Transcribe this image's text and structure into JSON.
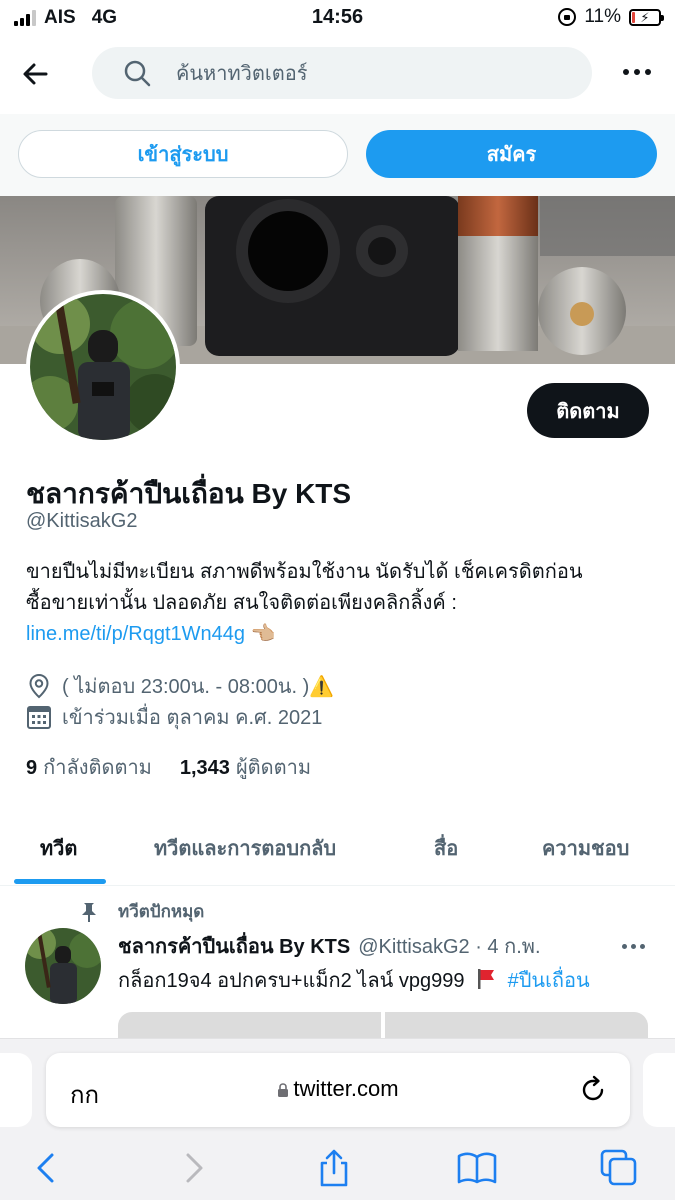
{
  "status_bar": {
    "carrier": "AIS",
    "network": "4G",
    "time": "14:56",
    "battery": "11%"
  },
  "search": {
    "placeholder": "ค้นหาทวิตเตอร์"
  },
  "auth": {
    "login_label": "เข้าสู่ระบบ",
    "signup_label": "สมัคร"
  },
  "profile": {
    "follow_label": "ติดตาม",
    "display_name": "ชลากรค้าปืนเถื่อน By KTS",
    "handle": "@KittisakG2",
    "bio_line1": "ขายปืนไม่มีทะเบียน สภาพดีพร้อมใช้งาน นัดรับได้ เช็คเครดิตก่อน",
    "bio_line2": "ซื้อขายเท่านั้น ปลอดภัย สนใจติดต่อเพียงคลิกลิ้งค์ :",
    "bio_link": "line.me/ti/p/Rqgt1Wn44g",
    "bio_link_emoji": "👈🏼",
    "location": "( ไม่ตอบ 23:00น. - 08:00น. )⚠️",
    "joined": "เข้าร่วมเมื่อ ตุลาคม ค.ศ. 2021",
    "following_count": "9",
    "following_label": "กำลังติดตาม",
    "followers_count": "1,343",
    "followers_label": "ผู้ติดตาม"
  },
  "tabs": [
    {
      "label": "ทวีต"
    },
    {
      "label": "ทวีตและการตอบกลับ"
    },
    {
      "label": "สื่อ"
    },
    {
      "label": "ความชอบ"
    }
  ],
  "pinned_tweet": {
    "pinned_label": "ทวีตปักหมุด",
    "name": "ชลากรค้าปืนเถื่อน By KTS",
    "handle_date": "@KittisakG2 · 4 ก.พ.",
    "text": "กล็อก19จ4 อปกครบ+แม็ก2 ไลน์ vpg999",
    "hashtag": "#ปืนเถื่อน"
  },
  "browser": {
    "aa_label": "กก",
    "url": "twitter.com"
  },
  "colors": {
    "accent": "#1d9bf0",
    "text": "#0f1419",
    "secondary_text": "#536471"
  }
}
